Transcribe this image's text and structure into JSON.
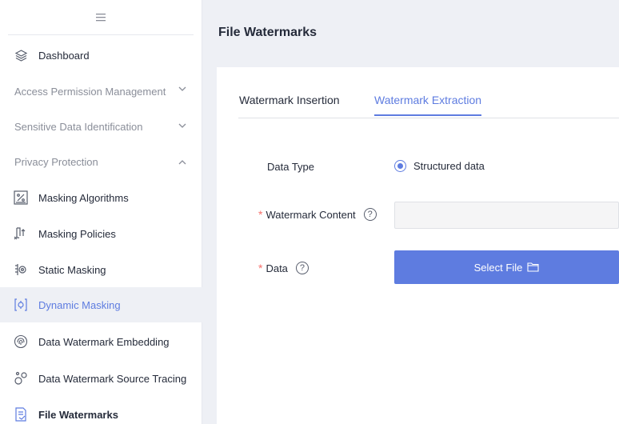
{
  "sidebar": {
    "toggle_icon": "menu-icon",
    "items": [
      {
        "label": "Dashboard",
        "icon": "layers-icon"
      },
      {
        "label": "Access Permission Management",
        "chevron": "v"
      },
      {
        "label": "Sensitive Data Identification",
        "chevron": "v"
      },
      {
        "label": "Privacy Protection",
        "chevron": "^"
      },
      {
        "label": "Masking Algorithms",
        "icon": "percent-box-icon"
      },
      {
        "label": "Masking Policies",
        "icon": "policy-icon"
      },
      {
        "label": "Static Masking",
        "icon": "static-masking-icon"
      },
      {
        "label": "Dynamic Masking",
        "icon": "dynamic-masking-icon"
      },
      {
        "label": "Data Watermark Embedding",
        "icon": "fingerprint-icon"
      },
      {
        "label": "Data Watermark Source Tracing",
        "icon": "trace-icon"
      },
      {
        "label": "File Watermarks",
        "icon": "file-watermark-icon"
      }
    ]
  },
  "main": {
    "title": "File Watermarks",
    "tabs": [
      {
        "label": "Watermark Insertion",
        "active": false
      },
      {
        "label": "Watermark Extraction",
        "active": true
      }
    ],
    "form": {
      "data_type_label": "Data Type",
      "data_type_value": "Structured data",
      "watermark_content_label": "Watermark Content",
      "watermark_content_value": "",
      "data_label": "Data",
      "select_file_label": "Select File",
      "required_mark": "*",
      "help_glyph": "?"
    }
  },
  "colors": {
    "accent": "#5e7ce0",
    "required": "#f66f6a",
    "hover_bg": "#eef0f5",
    "page_bg": "#eef0f5"
  }
}
